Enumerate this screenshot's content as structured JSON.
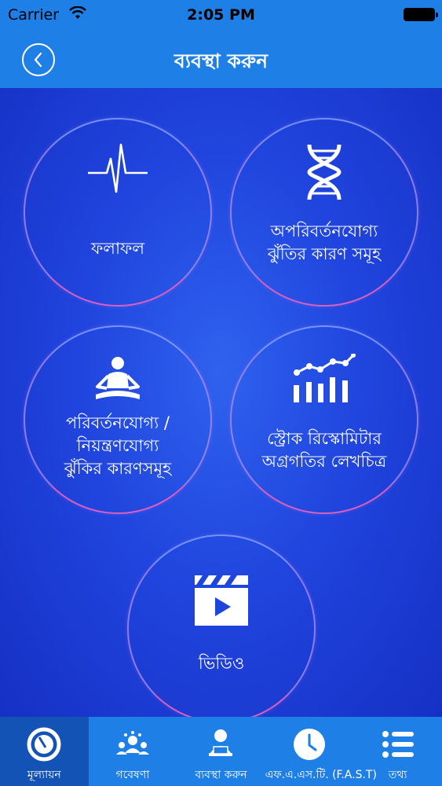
{
  "status_bar": {
    "carrier": "Carrier",
    "time": "2:05 PM"
  },
  "nav": {
    "title": "ব্যবস্থা করুন"
  },
  "tiles": [
    {
      "label": "ফলাফল",
      "icon": "heartbeat-icon"
    },
    {
      "label": "অপরিবর্তনযোগ্য\nঝুঁতির কারণ সমূহ",
      "icon": "dna-icon"
    },
    {
      "label": "পরিবর্তনযোগ্য /\nনিয়ন্ত্রণযোগ্য\nঝুঁকির কারণসমূহ",
      "icon": "meditation-icon"
    },
    {
      "label": "স্ট্রোক রিস্কোমিটার\nঅগ্রগতির লেখচিত্র",
      "icon": "progress-chart-icon"
    },
    {
      "label": "ভিডিও",
      "icon": "video-clapper-icon"
    }
  ],
  "tabs": [
    {
      "label": "মূল্যায়ন",
      "icon": "gauge-icon"
    },
    {
      "label": "গবেষণা",
      "icon": "research-people-icon"
    },
    {
      "label": "ব্যবস্থা করুন",
      "icon": "person-laptop-icon"
    },
    {
      "label": "এফ.এ.এস.টি. (F.A.S.T)",
      "icon": "clock-icon"
    },
    {
      "label": "তথ্য",
      "icon": "list-icon"
    }
  ],
  "colors": {
    "bar_blue": "#1e7fe6",
    "active_tab": "#1453b6",
    "background": "#1c3fd6"
  }
}
